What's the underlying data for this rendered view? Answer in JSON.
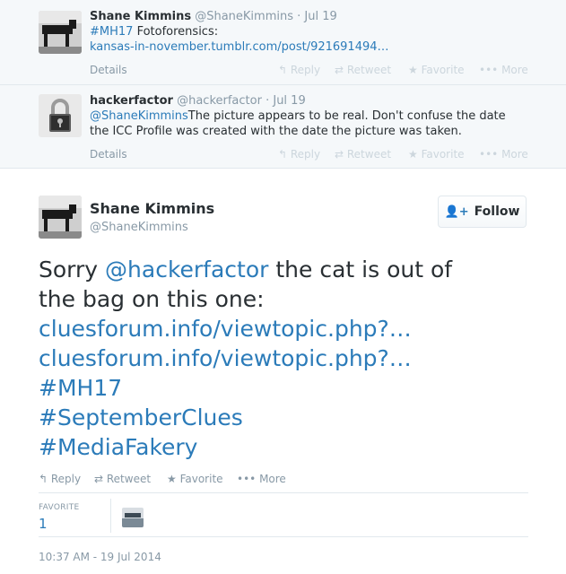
{
  "replies": [
    {
      "name": "Shane Kimmins",
      "handle": "@ShaneKimmins",
      "date": "· Jul 19",
      "hashtag": "#MH17",
      "text_after_hashtag": " Fotoforensics:",
      "link": "kansas-in-november.tumblr.com/post/921691494…",
      "details": "Details",
      "actions": [
        "Reply",
        "Retweet",
        "Favorite",
        "More"
      ]
    },
    {
      "name": "hackerfactor",
      "handle": "@hackerfactor",
      "date": "· Jul 19",
      "mention": "@ShaneKimmins",
      "text_line1": "The picture appears to be real. Don't confuse the date",
      "text_line2": "the ICC Profile was created with the date the picture was taken.",
      "details": "Details",
      "actions": [
        "Reply",
        "Retweet",
        "Favorite",
        "More"
      ]
    }
  ],
  "main": {
    "name": "Shane Kimmins",
    "handle": "@ShaneKimmins",
    "follow_label": "Follow",
    "text": {
      "line1_prefix": "Sorry ",
      "line1_mention": "@hackerfactor",
      "line1_suffix": " the cat is out of",
      "line2": "the bag on this one:",
      "link1": "cluesforum.info/viewtopic.php?…",
      "link2": "cluesforum.info/viewtopic.php?…",
      "hashtag1": "#MH17",
      "hashtag2": "#SeptemberClues",
      "hashtag3": "#MediaFakery"
    },
    "actions": [
      "Reply",
      "Retweet",
      "Favorite",
      "More"
    ],
    "favorite_label": "FAVORITE",
    "favorite_count": "1",
    "timestamp": "10:37 AM - 19 Jul 2014"
  },
  "colors": {
    "link": "#2b7bb9",
    "muted": "#8899a6",
    "reply_bg": "#f5f8fa"
  }
}
